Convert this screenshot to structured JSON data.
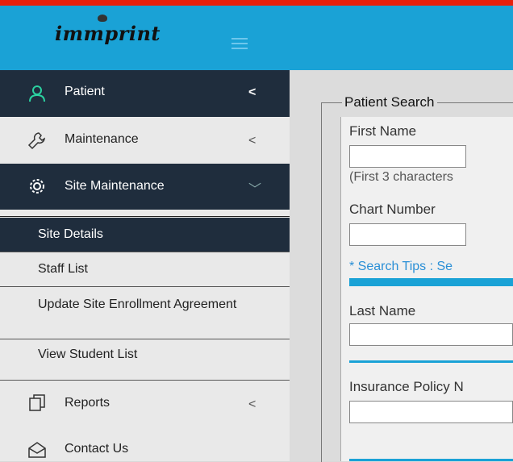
{
  "brand": {
    "logo_text": "immprint",
    "accent": "#1aa2d6",
    "nav_dark": "#1f2d3d"
  },
  "sidebar": {
    "patient": {
      "label": "Patient",
      "icon": "user-icon",
      "chevron": "<"
    },
    "maintenance": {
      "label": "Maintenance",
      "icon": "wrench-icon",
      "chevron": "<"
    },
    "site_maintenance": {
      "label": "Site Maintenance",
      "icon": "gear-icon",
      "chevron": "﹀"
    },
    "sub_items": [
      {
        "label": "Site Details"
      },
      {
        "label": "Staff List"
      },
      {
        "label": "Update Site Enrollment Agreement"
      },
      {
        "label": "View Student List"
      }
    ],
    "reports": {
      "label": "Reports",
      "icon": "copy-icon",
      "chevron": "<"
    },
    "contact": {
      "label": "Contact Us",
      "icon": "envelope-icon"
    }
  },
  "search": {
    "legend": "Patient Search",
    "first_name_label": "First Name",
    "first_name_value": "",
    "first_name_hint": "(First 3 characters",
    "chart_number_label": "Chart Number",
    "chart_number_value": "",
    "search_tips": "* Search Tips : Se",
    "last_name_label": "Last Name",
    "last_name_value": "",
    "insurance_label": "Insurance Policy N",
    "insurance_value": ""
  }
}
